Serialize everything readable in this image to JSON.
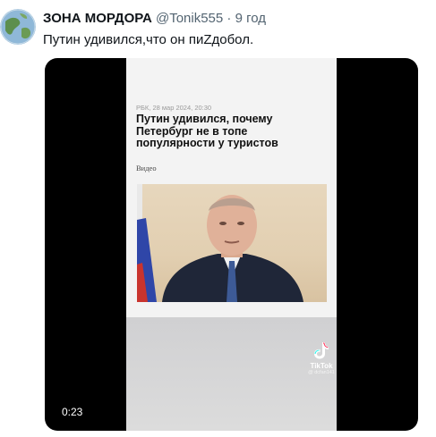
{
  "tweet": {
    "author": "ЗОНА МОРДОРА",
    "handle": "@Tonik555",
    "separator": "·",
    "time": "9 год",
    "text": "Путин удивился,что он пиZдобол."
  },
  "video": {
    "duration": "0:23",
    "article": {
      "meta": "РБК, 28 мар 2024, 20:30",
      "headline": "Путин удивился, почему Петербург не в топе популярности у туристов",
      "tag": "Видео"
    },
    "watermark": {
      "icon": "tiktok-logo-icon",
      "name": "TikTok",
      "user": "@ dcfan141"
    }
  },
  "colors": {
    "text_primary": "#0f1419",
    "text_secondary": "#536471",
    "video_bg": "#000000"
  }
}
